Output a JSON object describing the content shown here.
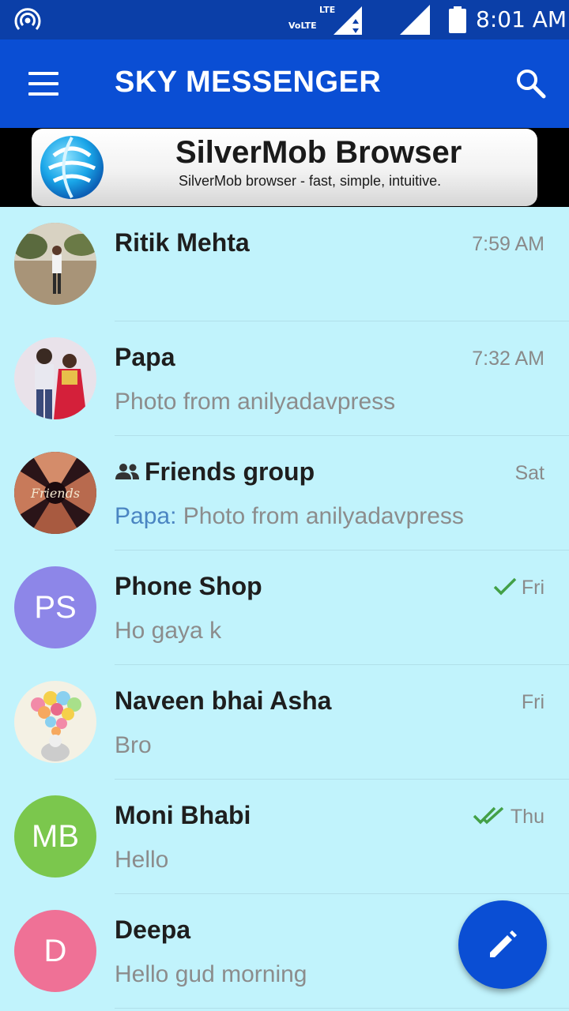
{
  "status_bar": {
    "lte": "LTE",
    "volte": "VoLTE",
    "time": "8:01 AM"
  },
  "app_bar": {
    "title": "SKY MESSENGER"
  },
  "ad": {
    "title": "SilverMob Browser",
    "subtitle": "SilverMob browser - fast, simple, intuitive."
  },
  "chats": [
    {
      "name": "Ritik Mehta",
      "time": "7:59 AM",
      "message": ""
    },
    {
      "name": "Papa",
      "time": "7:32 AM",
      "message": "Photo from anilyadavpress"
    },
    {
      "name": "Friends group",
      "time": "Sat",
      "sender": "Papa:",
      "message": "Photo from anilyadavpress"
    },
    {
      "name": "Phone Shop",
      "time": "Fri",
      "initials": "PS",
      "message": "Ho gaya k"
    },
    {
      "name": "Naveen bhai Asha",
      "time": "Fri",
      "message": "Bro"
    },
    {
      "name": "Moni Bhabi",
      "time": "Thu",
      "initials": "MB",
      "message": "Hello"
    },
    {
      "name": "Deepa",
      "time": "",
      "initials": "D",
      "message": "Hello gud morning"
    }
  ],
  "colors": {
    "status_bar": "#0b3fa8",
    "app_bar": "#0a4ed4",
    "list_bg": "#c1f3fc",
    "tick_green": "#43a047",
    "avatar_ps": "#8d86e8",
    "avatar_mb": "#7bc74d",
    "avatar_d": "#ef7196"
  },
  "icons": {
    "status": [
      "hotspot-icon",
      "lte-signal-icon",
      "signal-icon",
      "battery-icon"
    ],
    "app_bar": [
      "menu-icon",
      "search-icon"
    ],
    "fab": "pencil-icon"
  }
}
